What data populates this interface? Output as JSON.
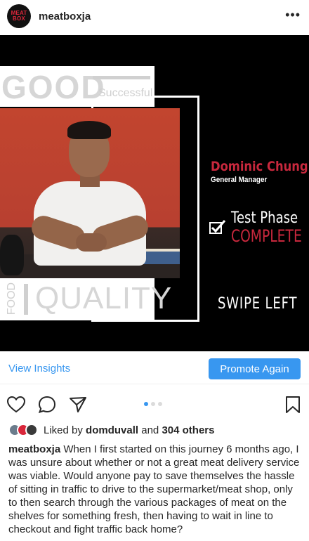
{
  "header": {
    "username": "meatboxja",
    "avatar_line1": "MEAT",
    "avatar_line2": "BOX",
    "more_label": "•••"
  },
  "post": {
    "good_word": "GOOD",
    "good_subtitle": "Successful",
    "food_word": "FOOD",
    "quality_word": "QUALITY",
    "person_name": "Dominic Chung",
    "person_role": "General Manager",
    "phase_line1": "Test Phase",
    "phase_line2": "COMPLETE",
    "swipe_text": "SWIPE LEFT"
  },
  "insights": {
    "view_label": "View Insights",
    "promote_label": "Promote Again"
  },
  "carousel": {
    "total": 3,
    "active": 0
  },
  "likes": {
    "prefix": "Liked by",
    "user": "domduvall",
    "connector": "and",
    "others": "304 others"
  },
  "caption": {
    "username": "meatboxja",
    "text": "When I first started on this journey 6 months ago, I was unsure about whether or not a great meat delivery service was viable. Would anyone pay to save themselves the hassle of sitting in traffic to drive to the supermarket/meat shop, only to then search through the various packages of meat on the shelves for something fresh, then having to wait in line to checkout and fight traffic back home?"
  },
  "colors": {
    "accent_blue": "#3897f0",
    "brand_red": "#c8283d",
    "post_background": "#000000"
  }
}
